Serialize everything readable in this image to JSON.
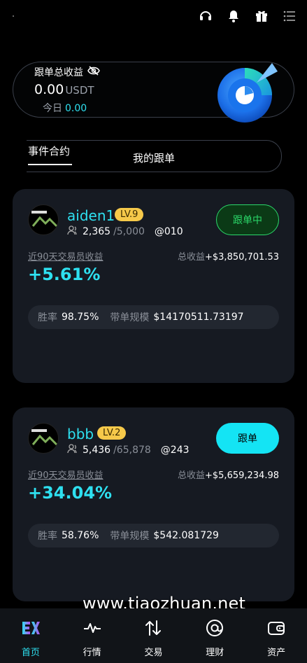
{
  "header": {
    "icons": [
      "headset-icon",
      "notification-bell-icon",
      "gift-icon",
      "menu-icon"
    ]
  },
  "earnings": {
    "title": "跟单总收益",
    "value": "0.00",
    "unit": "USDT",
    "today_label": "今日",
    "today_value": "0.00"
  },
  "tabs": [
    {
      "label": "事件合约",
      "active": true
    },
    {
      "label": "我的跟单",
      "active": false
    }
  ],
  "traders": [
    {
      "name": "aiden1",
      "level": "LV.9",
      "followers": "2,365",
      "max_followers": "/5,000",
      "handle": "@010",
      "action": "跟单中",
      "period_label": "近90天交易员收益",
      "total_label": "总收益",
      "total_value": "+$3,850,701.53",
      "percent": "+5.61%",
      "win_label": "胜率",
      "win_value": "98.75%",
      "scale_label": "带单规模",
      "scale_value": "$14170511.73197"
    },
    {
      "name": "bbb",
      "level": "LV.2",
      "followers": "5,436",
      "max_followers": "/65,878",
      "handle": "@243",
      "action": "跟单",
      "period_label": "近90天交易员收益",
      "total_label": "总收益",
      "total_value": "+$5,659,234.98",
      "percent": "+34.04%",
      "win_label": "胜率",
      "win_value": "58.76%",
      "scale_label": "带单规模",
      "scale_value": "$542.081729"
    }
  ],
  "watermark": "www.tiaozhuan.net",
  "nav": [
    {
      "label": "首页",
      "icon": "ex-logo-icon",
      "active": true
    },
    {
      "label": "行情",
      "icon": "pulse-chart-icon",
      "active": false
    },
    {
      "label": "交易",
      "icon": "swap-arrows-icon",
      "active": false
    },
    {
      "label": "理财",
      "icon": "at-circle-icon",
      "active": false
    },
    {
      "label": "资产",
      "icon": "wallet-icon",
      "active": false
    }
  ],
  "colors": {
    "accent": "#2ee0f0",
    "following_green": "#2bd86a",
    "level_badge": "#f6c94a",
    "card_bg": "#161a22"
  }
}
